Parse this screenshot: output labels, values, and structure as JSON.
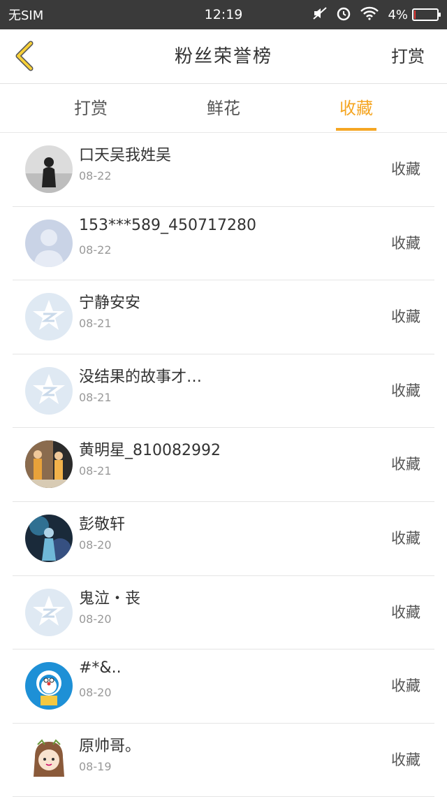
{
  "status_bar": {
    "carrier": "无SIM",
    "time": "12:19",
    "battery_percent": "4%",
    "battery_level": 0.04,
    "icons": [
      "mute-icon",
      "alarm-icon",
      "wifi-icon",
      "battery-icon"
    ]
  },
  "header": {
    "title": "粉丝荣誉榜",
    "right_action": "打赏",
    "back_icon": "chevron-left-icon",
    "accent_color": "#f5a623"
  },
  "tabs": [
    {
      "label": "打赏",
      "active": false
    },
    {
      "label": "鲜花",
      "active": false
    },
    {
      "label": "收藏",
      "active": true
    }
  ],
  "fans": [
    {
      "name": "口天吴我姓吴",
      "date": "08-22",
      "action": "收藏",
      "avatar": "photo-person"
    },
    {
      "name": "153***589_450717280",
      "date": "08-22",
      "action": "收藏",
      "avatar": "default-person"
    },
    {
      "name": "宁静安安",
      "date": "08-21",
      "action": "收藏",
      "avatar": "qq-star"
    },
    {
      "name": "没结果的故事才…",
      "date": "08-21",
      "action": "收藏",
      "avatar": "qq-star"
    },
    {
      "name": "黄明星_810082992",
      "date": "08-21",
      "action": "收藏",
      "avatar": "photo-people"
    },
    {
      "name": "彭敬轩",
      "date": "08-20",
      "action": "收藏",
      "avatar": "photo-anime"
    },
    {
      "name": "鬼泣・丧",
      "date": "08-20",
      "action": "收藏",
      "avatar": "qq-star"
    },
    {
      "name": "#*&..",
      "date": "08-20",
      "action": "收藏",
      "avatar": "doraemon"
    },
    {
      "name": "原帅哥。",
      "date": "08-19",
      "action": "收藏",
      "avatar": "cartoon-girl"
    }
  ]
}
